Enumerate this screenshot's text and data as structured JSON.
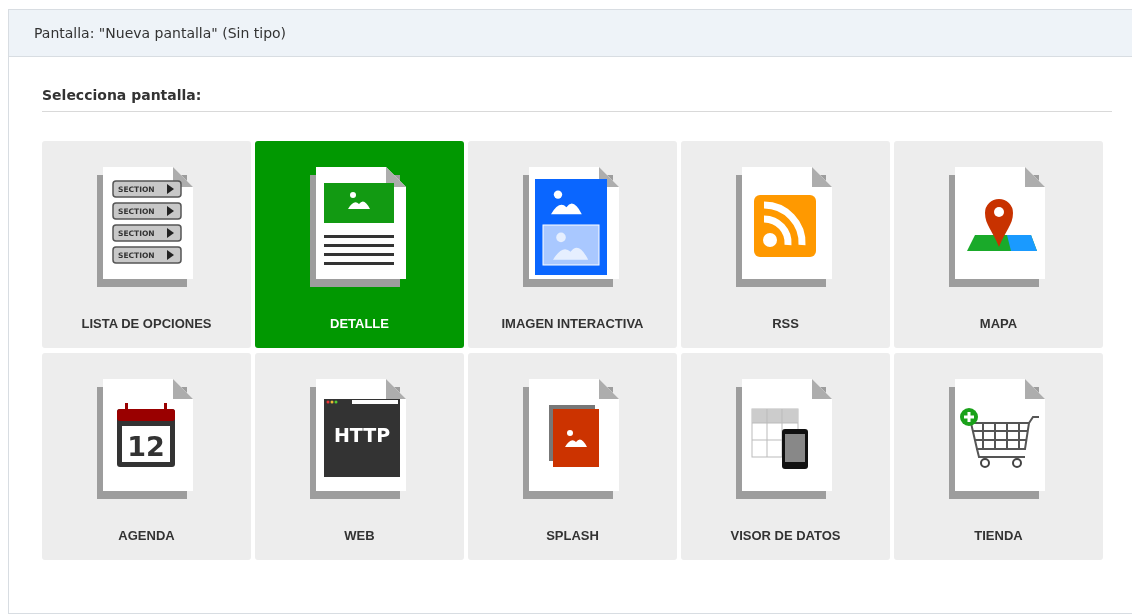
{
  "panel": {
    "title": "Pantalla: \"Nueva pantalla\" (Sin tipo)"
  },
  "section_title": "Selecciona pantalla:",
  "tiles": [
    {
      "label": "LISTA DE OPCIONES",
      "kind": "list",
      "selected": false,
      "icon_texts": [
        "SECTION",
        "SECTION",
        "SECTION",
        "SECTION"
      ]
    },
    {
      "label": "DETALLE",
      "kind": "detail",
      "selected": true
    },
    {
      "label": "IMAGEN INTERACTIVA",
      "kind": "interactive",
      "selected": false
    },
    {
      "label": "RSS",
      "kind": "rss",
      "selected": false
    },
    {
      "label": "MAPA",
      "kind": "map",
      "selected": false
    },
    {
      "label": "AGENDA",
      "kind": "agenda",
      "selected": false,
      "icon_texts": [
        "12"
      ]
    },
    {
      "label": "WEB",
      "kind": "web",
      "selected": false,
      "icon_texts": [
        "HTTP"
      ]
    },
    {
      "label": "SPLASH",
      "kind": "splash",
      "selected": false
    },
    {
      "label": "VISOR DE DATOS",
      "kind": "viewer",
      "selected": false
    },
    {
      "label": "TIENDA",
      "kind": "store",
      "selected": false
    }
  ]
}
